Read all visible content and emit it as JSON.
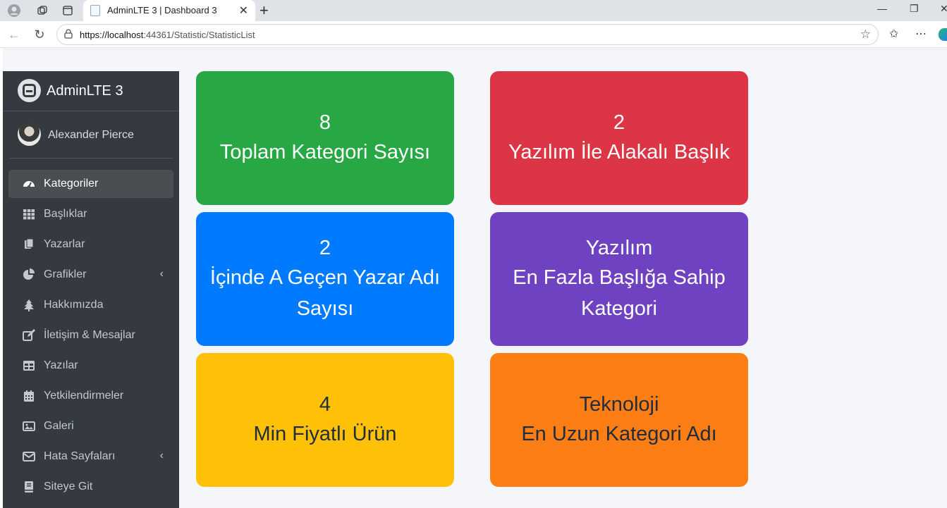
{
  "browser": {
    "tab_title": "AdminLTE 3 | Dashboard 3",
    "url_host": "https://localhost",
    "url_rest": ":44361/Statistic/StatisticList"
  },
  "sidebar": {
    "brand": "AdminLTE 3",
    "user_name": "Alexander Pierce",
    "items": [
      {
        "label": "Kategoriler",
        "icon": "tachometer-icon",
        "active": true
      },
      {
        "label": "Başlıklar",
        "icon": "grid-icon"
      },
      {
        "label": "Yazarlar",
        "icon": "copy-icon"
      },
      {
        "label": "Grafikler",
        "icon": "pie-chart-icon",
        "has_chevron": true
      },
      {
        "label": "Hakkımızda",
        "icon": "tree-icon"
      },
      {
        "label": "İletişim & Mesajlar",
        "icon": "edit-icon"
      },
      {
        "label": "Yazılar",
        "icon": "table-icon"
      },
      {
        "label": "Yetkilendirmeler",
        "icon": "calendar-icon"
      },
      {
        "label": "Galeri",
        "icon": "image-icon"
      },
      {
        "label": "Hata Sayfaları",
        "icon": "envelope-icon",
        "has_chevron": true
      },
      {
        "label": "Siteye Git",
        "icon": "book-icon"
      }
    ]
  },
  "cards": [
    {
      "value": "8",
      "label": "Toplam Kategori Sayısı",
      "color": "#28a745"
    },
    {
      "value": "2",
      "label": "Yazılım İle Alakalı Başlık",
      "color": "#dc3545"
    },
    {
      "value": "2",
      "label": "İçinde A Geçen Yazar Adı Sayısı",
      "color": "#007bff"
    },
    {
      "value": "Yazılım",
      "label": "En Fazla Başlığa Sahip Kategori",
      "color": "#6f42c1"
    },
    {
      "value": "4",
      "label": "Min Fiyatlı Ürün",
      "color": "#ffc107"
    },
    {
      "value": "Teknoloji",
      "label": "En Uzun Kategori Adı",
      "color": "#fd7e14"
    }
  ]
}
